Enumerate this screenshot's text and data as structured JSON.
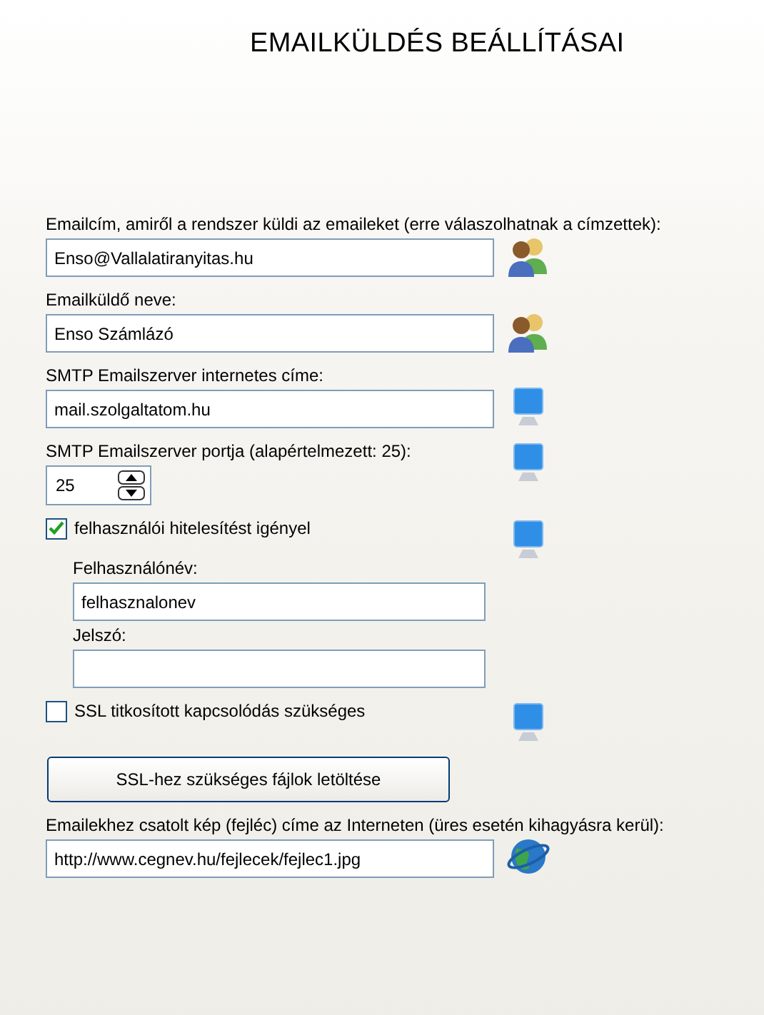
{
  "title": "EMAILKÜLDÉS BEÁLLÍTÁSAI",
  "rows": [
    {
      "kind": "field",
      "label": "Emailcím, amiről a rendszer küldi az emaileket (erre válaszolhatnak a címzettek):",
      "value": "Enso@Vallalatiranyitas.hu"
    },
    {
      "kind": "field",
      "label": "Emailküldő neve:",
      "value": "Enso Számlázó"
    },
    {
      "kind": "field",
      "label": "SMTP Emailszerver internetes címe:",
      "value": "mail.szolgaltatom.hu"
    },
    {
      "kind": "spinner",
      "label": "SMTP Emailszerver portja (alapértelmezett: 25):",
      "value": "25"
    },
    {
      "kind": "checkbox",
      "label": "felhasználói hitelesítést igényel",
      "checked": true,
      "children": [
        {
          "kind": "field",
          "label": "Felhasználónév:",
          "value": "felhasznalonev"
        },
        {
          "kind": "field",
          "label": "Jelszó:"
        }
      ]
    },
    {
      "kind": "checkbox",
      "label": "SSL titkosított kapcsolódás szükséges",
      "checked": false
    },
    {
      "kind": "button",
      "label": "SSL-hez szükséges fájlok letöltése"
    },
    {
      "kind": "field",
      "label": "Emailekhez csatolt kép (fejléc) címe az Interneten (üres esetén kihagyásra kerül):",
      "value": "http://www.cegnev.hu/fejlecek/fejlec1.jpg"
    }
  ]
}
